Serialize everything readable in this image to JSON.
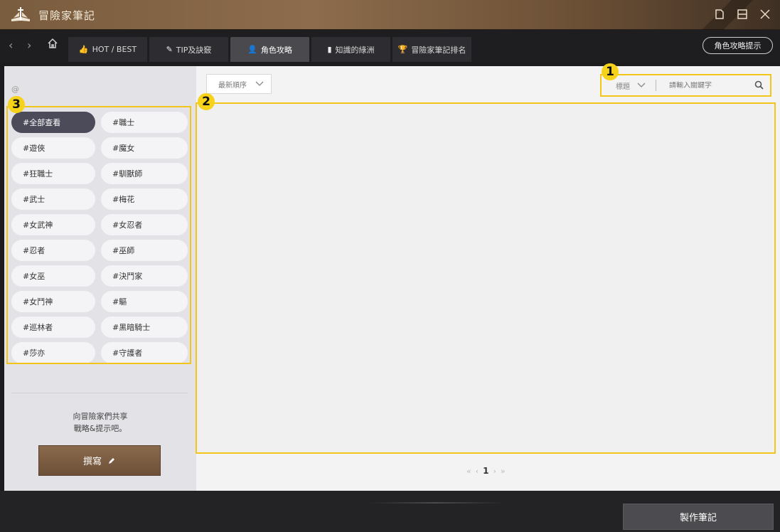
{
  "window": {
    "title": "冒險家筆記",
    "controls": [
      "minimize",
      "maximize",
      "close"
    ]
  },
  "nav": {
    "tabs": [
      {
        "label": "HOT / BEST",
        "icon": "thumbs-up-icon"
      },
      {
        "label": "TIP及訣竅",
        "icon": "pencil-icon"
      },
      {
        "label": "角色攻略",
        "icon": "person-icon",
        "active": true
      },
      {
        "label": "知識的綠洲",
        "icon": "book-icon"
      },
      {
        "label": "冒險家筆記排名",
        "icon": "trophy-icon"
      }
    ],
    "hint_button": "角色攻略提示"
  },
  "sidebar": {
    "at_symbol": "@",
    "hashtags": [
      "#全部查看",
      "#職士",
      "#遊俠",
      "#魔女",
      "#狂職士",
      "#馴獸師",
      "#武士",
      "#梅花",
      "#女武神",
      "#女忍者",
      "#忍者",
      "#巫師",
      "#女巫",
      "#決鬥家",
      "#女鬥神",
      "#驅",
      "#巡林者",
      "#黑暗騎士",
      "#莎亦",
      "#守護者"
    ],
    "active_tag": "#全部查看",
    "share_line1": "向冒險家們共享",
    "share_line2": "戰略&提示吧。",
    "write_button": "撰寫"
  },
  "main": {
    "sort_select": "最新順序",
    "search_type": "標題",
    "search_placeholder": "請輸入關鍵字",
    "pager": {
      "first": "«",
      "prev": "‹",
      "current": "1",
      "next": "›",
      "last": "»"
    }
  },
  "callouts": [
    "1",
    "2",
    "3"
  ],
  "bottom": {
    "make_button": "製作筆記"
  },
  "colors": {
    "accent_brown": "#7a5c3e",
    "callout_yellow": "#f2c51b",
    "active_tag": "#4b4b59"
  }
}
